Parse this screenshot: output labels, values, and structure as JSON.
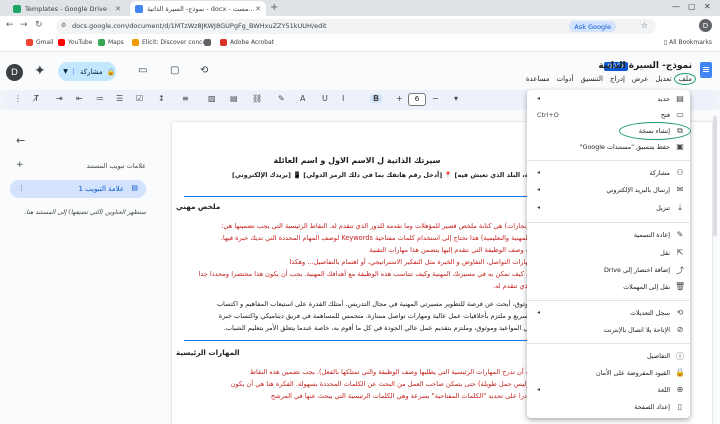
{
  "browser": {
    "tabs": [
      {
        "title": "Templates - Google Drive",
        "favicon_color": "#1fa463"
      },
      {
        "title": "نموذج- السيرة الذاتية - docx - مست...",
        "favicon_color": "#4285f4"
      }
    ],
    "new_tab": "+",
    "url": "docs.google.com/document/d/1MTzWz8JKWJ8GUPgFg_BWHxuZZY51kUUH/edit",
    "ask_google": "Ask Google",
    "profile_initial": "D",
    "bookmarks": [
      {
        "label": "Gmail",
        "color": "#ea4335"
      },
      {
        "label": "YouTube",
        "color": "#ff0000"
      },
      {
        "label": "Maps",
        "color": "#34a853"
      },
      {
        "label": "Elicit: Discover conce...",
        "color": "#f29900"
      },
      {
        "label": "",
        "color": "#5f6368"
      },
      {
        "label": "Adobe Acrobat",
        "color": "#d93025"
      }
    ],
    "all_bookmarks": "All Bookmarks"
  },
  "docs": {
    "user_initial": "D",
    "share_label": "مشاركة",
    "title": "نموذج- السيرة الذاتية",
    "badge": "DOCX",
    "menus": [
      "ملف",
      "تعديل",
      "عرض",
      "إدراج",
      "التنسيق",
      "أدوات",
      "مساعدة"
    ],
    "font_size": "6"
  },
  "outline": {
    "header": "علامات تبويب المستند",
    "tab_label": "علامة التبويب 1",
    "hint": "ستظهر العناوين (التي تضيفها) إلى المستند هنا."
  },
  "page": {
    "title": "سيرتك الذاتية ل الاسم الاول و اسم العائلة",
    "contact": "[أدخل المدينة، البلد الذي تعيش فيه] 📍 [أدخل رقم هاتفك بما في ذلك الرمز الدولي] 📱 [بريدك الإلكتروني]",
    "section1": "ملخص مهني",
    "lines1": [
      "الإنجازات) هي كتابة ملخص قصير للمؤهلات وما تقدمه للدور الذي تتقدم له. النقاط الرئيسية التي يجب تضمينها هي:",
      "(المهنية والتعليمية) هذا تحتاج إلى استخدام كلمات مفتاحية Keywords لوصف المهام المحددة التي تديك خبرة فيها.",
      "ت وصف الوظيفة التي تتقدم إليها يتضمن هذا مهارات التقنية",
      "مهارات التواصل، التفاوض و الخبرة مثل التفكير الاستراتيجي، أو اهتمام بالتفاصيل... وهكذا",
      "ع، كيف تمكن به في مسيرتك المهنية وكيف تتناسب هذه الوظيفة مع أهدافك المهنية. يجب أن يكون هذا مختصرا ومحددا جدا",
      "الذي تتقدم له."
    ],
    "lines2": [
      "موثوق، أبحث عن فرصة للتطوير مسيرتي المهنية في مجال التدريس. أمتلك القدرة على استيعاب المفاهيم و اكتساب",
      "، سريع و ملتزم بأخلاقيات عمل عالية ومهارات تواصل ممتازة. متحمس للمساهمة في فريق ديناميكي واكتساب خبرة",
      "في المواعيد وموثوق، وملتزم بتقديم عمل عالي الجودة في كل ما أقوم به، خاصة عندما يتعلق الأمر بتعليم الشباب."
    ],
    "section2": "المهارات الرئيسية",
    "lines3": [
      "ب أن تدرج المهارات الرئيسية التي يطلبها وصف الوظيفة والتي تمتلكها بالفعل). يجب تضمين هذه النقاط",
      "(وليس جمل طويلة) حتى يتمكن صاحب العمل من البحث عن الكلمات المحددة بسهولة. الفكرة هنا هي أن يكون",
      "قادرا على تحديد \"الكلمات المفتاحية\" بسرعة وهي الكلمات الرئيسية التي يبحث عنها في المرشح"
    ]
  },
  "file_menu": {
    "items": [
      {
        "label": "جديد",
        "icon": "new-doc-icon",
        "glyph": "▤",
        "arrow": true
      },
      {
        "label": "فتح",
        "icon": "folder-icon",
        "glyph": "▭",
        "shortcut": "Ctrl+O"
      },
      {
        "label": "إنشاء نسخة",
        "icon": "copy-icon",
        "glyph": "⧉"
      },
      {
        "label": "حفظ بتنسيق \"مستندات Google\"",
        "icon": "docs-format-icon",
        "glyph": "▣"
      },
      {
        "label": "مشاركة",
        "icon": "person-add-icon",
        "glyph": "⚇",
        "arrow": true
      },
      {
        "label": "إرسال بالبريد الإلكتروني",
        "icon": "email-icon",
        "glyph": "✉",
        "arrow": true
      },
      {
        "label": "تنزيل",
        "icon": "download-icon",
        "glyph": "⤓",
        "arrow": true
      },
      {
        "label": "إعادة التسمية",
        "icon": "rename-icon",
        "glyph": "✎"
      },
      {
        "label": "نقل",
        "icon": "move-icon",
        "glyph": "⇱"
      },
      {
        "label": "إضافة اختصار إلى Drive",
        "icon": "drive-shortcut-icon",
        "glyph": "⤴"
      },
      {
        "label": "نقل إلى المهملات",
        "icon": "trash-icon",
        "glyph": "🗑"
      },
      {
        "label": "سجل التعديلات",
        "icon": "history-icon",
        "glyph": "⟲",
        "arrow": true
      },
      {
        "label": "الإتاحة بلا اتصال بالإنترنت",
        "icon": "offline-icon",
        "glyph": "⊘"
      },
      {
        "label": "التفاصيل",
        "icon": "info-icon",
        "glyph": "ⓘ"
      },
      {
        "label": "القيود المفروضة على الأمان",
        "icon": "security-icon",
        "glyph": "🔒"
      },
      {
        "label": "اللغة",
        "icon": "globe-icon",
        "glyph": "⊕",
        "arrow": true
      },
      {
        "label": "إعداد الصفحة",
        "icon": "page-setup-icon",
        "glyph": "▯"
      }
    ]
  }
}
